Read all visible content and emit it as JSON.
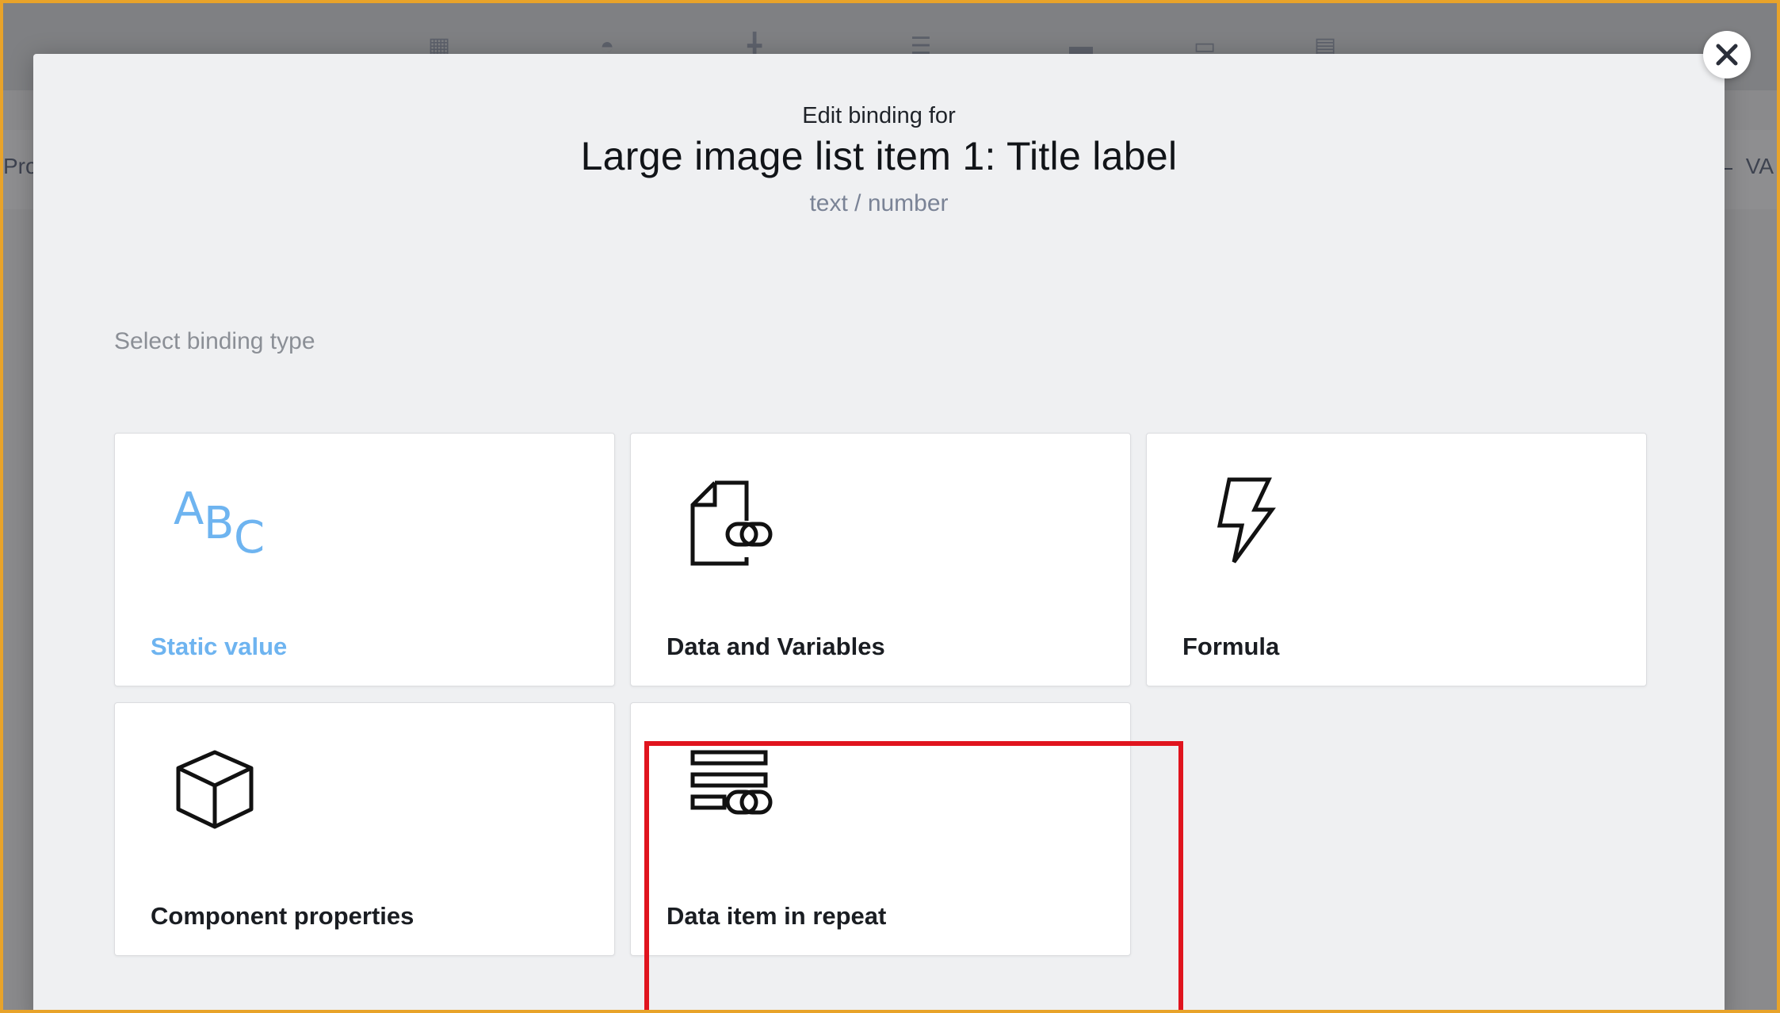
{
  "background": {
    "left_text": "Pro",
    "right_text": "VA"
  },
  "modal": {
    "subtitle": "Edit binding for",
    "title": "Large image list item 1: Title label",
    "value_type": "text / number",
    "section_label": "Select binding type",
    "close_icon": "close-icon",
    "options": [
      {
        "label": "Static value",
        "icon": "abc-icon",
        "selected": true
      },
      {
        "label": "Data and Variables",
        "icon": "document-link-icon",
        "selected": false
      },
      {
        "label": "Formula",
        "icon": "lightning-icon",
        "selected": false
      },
      {
        "label": "Component properties",
        "icon": "cube-icon",
        "selected": false
      },
      {
        "label": "Data item in repeat",
        "icon": "list-link-icon",
        "selected": false
      }
    ]
  },
  "colors": {
    "accent": "#6eb4f0",
    "highlight": "#e0141e",
    "outer_border": "#e8a32a"
  }
}
